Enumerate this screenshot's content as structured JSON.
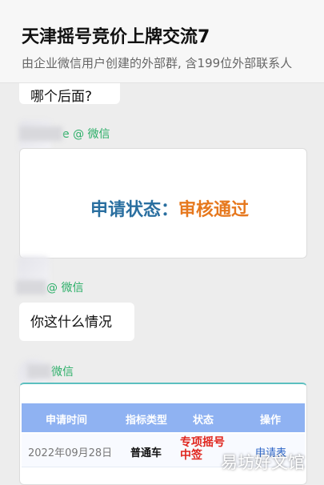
{
  "header": {
    "title": "天津摇号竞价上牌交流7",
    "subtitle": "由企业微信用户创建的外部群, 含199位外部联系人"
  },
  "messages": [
    {
      "text": "哪个后面?"
    },
    {
      "sender_suffix": "e @ 微信",
      "card": {
        "status_label": "申请状态：",
        "status_value": "审核通过"
      }
    },
    {
      "sender_suffix": "@ 微信",
      "text": "你这什么情况"
    },
    {
      "sender_suffix": "微信",
      "table": {
        "headers": [
          "申请时间",
          "指标类型",
          "状态",
          "操作"
        ],
        "row": {
          "date": "2022年09月28日",
          "type": "普通车",
          "status": "专项摇号中签",
          "action": "申请表"
        }
      }
    }
  ],
  "watermark": "易坊好文馆",
  "colors": {
    "sender_suffix": "#2aae67",
    "status_label": "#2a6fa0",
    "status_value": "#e6781e",
    "table_header": "#8fb2f2",
    "table_status": "#e0261e",
    "table_action": "#2f67c8"
  }
}
